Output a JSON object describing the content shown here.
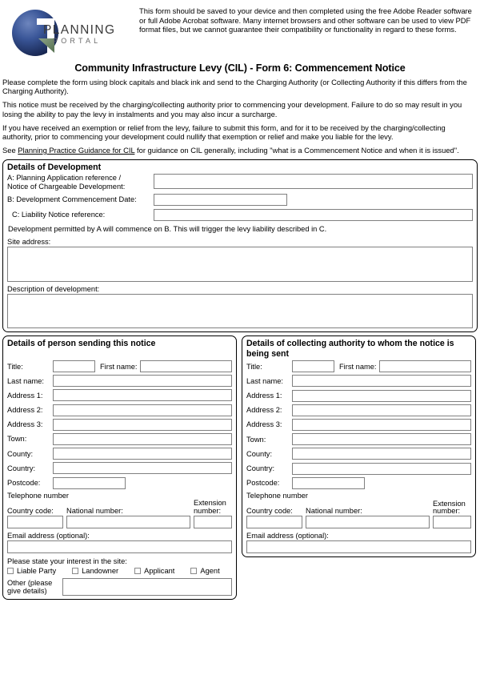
{
  "logo": {
    "word1": "PLANNING",
    "word2": "PORTAL",
    "icon": "planning-portal-logo"
  },
  "intro_text": "This form should be saved to your device and then completed using the free Adobe Reader software or full Adobe Acrobat software. Many internet browsers and other software can be used to view PDF format files, but we cannot guarantee their compatibility or functionality in regard to these forms.",
  "form_title": "Community Infrastructure Levy (CIL) - Form 6: Commencement Notice",
  "notes": {
    "p1": "Please complete the form using block capitals and black ink and send to the Charging Authority (or Collecting Authority if this differs from the Charging Authority).",
    "p2": "This notice must be received by the charging/collecting authority prior to commencing your development.  Failure to do so may result in you losing the ability to pay the levy in instalments and you may also incur a surcharge.",
    "p3": "If you have received an exemption or relief from the levy, failure to submit this form, and for it to be received by the charging/collecting authority, prior to commencing your development could nullify that exemption or relief and make you liable for the levy.",
    "p4_pre": "See ",
    "p4_link": "Planning Practice Guidance for CIL",
    "p4_post": " for guidance on CIL generally, including \"what is a Commencement Notice and when it is issued\"."
  },
  "development": {
    "title": "Details of Development",
    "field_a_line1": "A: Planning Application reference /",
    "field_a_line2": "Notice of Chargeable Development:",
    "field_a_value": "",
    "field_b_label": "B: Development Commencement Date:",
    "field_b_value": "",
    "field_c_label": "C: Liability Notice reference:",
    "field_c_value": "",
    "note": "Development permitted by A will commence on B. This will trigger the levy liability described in C.",
    "site_address_label": "Site address:",
    "site_address_value": "",
    "description_label": "Description of development:",
    "description_value": ""
  },
  "sender": {
    "title": "Details of person sending this notice",
    "title_label": "Title:",
    "title_value": "",
    "first_name_label": "First name:",
    "first_name_value": "",
    "last_name_label": "Last name:",
    "last_name_value": "",
    "address1_label": "Address 1:",
    "address1_value": "",
    "address2_label": "Address 2:",
    "address2_value": "",
    "address3_label": "Address 3:",
    "address3_value": "",
    "town_label": "Town:",
    "town_value": "",
    "county_label": "County:",
    "county_value": "",
    "country_label": "Country:",
    "country_value": "",
    "postcode_label": "Postcode:",
    "postcode_value": "",
    "telephone_heading": "Telephone number",
    "country_code_label": "Country code:",
    "country_code_value": "",
    "national_number_label": "National number:",
    "national_number_value": "",
    "extension_label_line1": "Extension",
    "extension_label_line2": "number:",
    "extension_value": "",
    "email_label": "Email address (optional):",
    "email_value": "",
    "interest_label": "Please state your interest in the site:",
    "interest_options": [
      {
        "label": "Liable Party",
        "checked": false
      },
      {
        "label": "Landowner",
        "checked": false
      },
      {
        "label": "Applicant",
        "checked": false
      },
      {
        "label": "Agent",
        "checked": false
      }
    ],
    "other_label_line1": "Other (please",
    "other_label_line2": "give details)",
    "other_value": ""
  },
  "authority": {
    "title": "Details of collecting authority to whom the notice is being sent",
    "title_label": "Title:",
    "title_value": "",
    "first_name_label": "First name:",
    "first_name_value": "",
    "last_name_label": "Last name:",
    "last_name_value": "",
    "address1_label": "Address 1:",
    "address1_value": "",
    "address2_label": "Address 2:",
    "address2_value": "",
    "address3_label": "Address 3:",
    "address3_value": "",
    "town_label": "Town:",
    "town_value": "",
    "county_label": "County:",
    "county_value": "",
    "country_label": "Country:",
    "country_value": "",
    "postcode_label": "Postcode:",
    "postcode_value": "",
    "telephone_heading": "Telephone number",
    "country_code_label": "Country code:",
    "country_code_value": "",
    "national_number_label": "National number:",
    "national_number_value": "",
    "extension_label_line1": "Extension",
    "extension_label_line2": "number:",
    "extension_value": "",
    "email_label": "Email address (optional):",
    "email_value": ""
  },
  "colors": {
    "logo_blue": "#2e4a8c",
    "logo_green": "#6f8a6a",
    "border": "#000000",
    "input_border": "#808080"
  }
}
